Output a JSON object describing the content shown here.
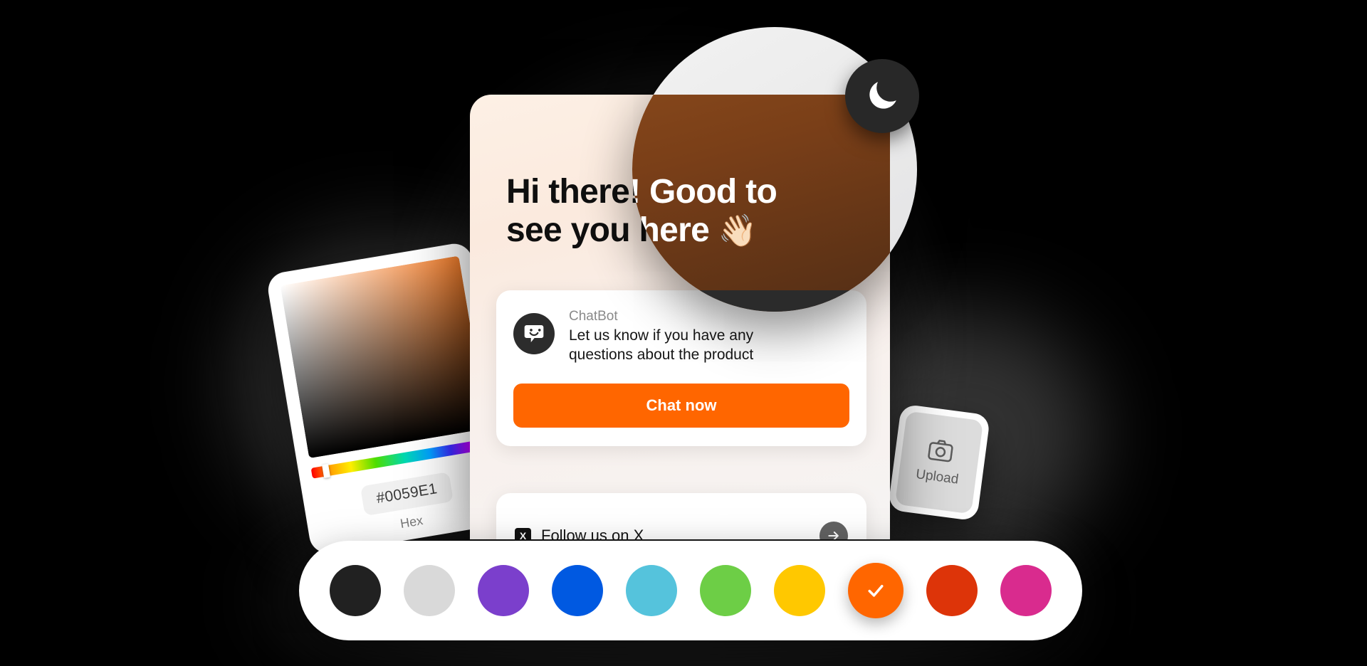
{
  "background_color": "#000000",
  "widget": {
    "heading_line1": "Hi there! Good to",
    "heading_line2": "see you here",
    "wave_emoji": "👋🏻",
    "chat": {
      "bot_name": "ChatBot",
      "message_line1": "Let us know if you have any",
      "message_line2": "questions about the product",
      "button_label": "Chat now",
      "button_color": "#FF6600",
      "avatar_icon": "chat-bubble-icon"
    },
    "social": {
      "label": "Follow us on X",
      "mark": "X",
      "arrow_icon": "arrow-right-icon"
    }
  },
  "color_picker": {
    "hex_value": "#0059E1",
    "hex_label": "Hex",
    "gradient_from": "#FFFFFF",
    "gradient_to": "#F07D2C"
  },
  "upload": {
    "label": "Upload",
    "icon": "camera-icon"
  },
  "magnifier": {
    "mode_icon": "moon-icon",
    "preview_heading_line1": "Hi there! Good to",
    "preview_heading_line2": "see you here",
    "preview_wave": "👋🏻"
  },
  "swatches": [
    {
      "name": "black",
      "color": "#212121",
      "selected": false
    },
    {
      "name": "light-gray",
      "color": "#D9D9D9",
      "selected": false
    },
    {
      "name": "purple",
      "color": "#7B3FCC",
      "selected": false
    },
    {
      "name": "blue",
      "color": "#0059E1",
      "selected": false
    },
    {
      "name": "cyan",
      "color": "#55C3DC",
      "selected": false
    },
    {
      "name": "green",
      "color": "#6DCE46",
      "selected": false
    },
    {
      "name": "yellow",
      "color": "#FFC800",
      "selected": false
    },
    {
      "name": "orange",
      "color": "#FF6600",
      "selected": true
    },
    {
      "name": "red",
      "color": "#DD3409",
      "selected": false
    },
    {
      "name": "magenta",
      "color": "#D92B8E",
      "selected": false
    }
  ]
}
